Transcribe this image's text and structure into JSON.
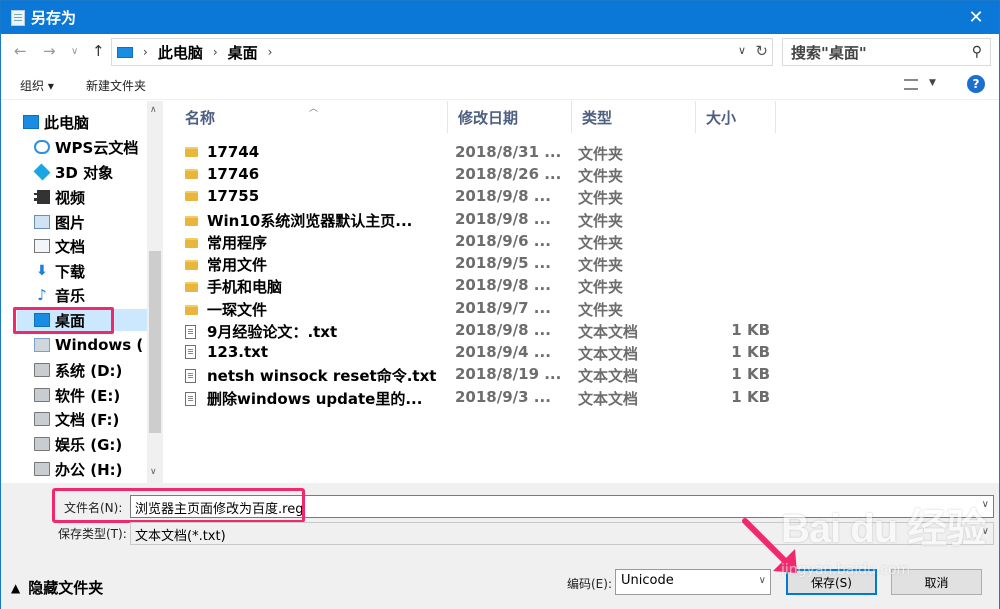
{
  "window": {
    "title": "另存为"
  },
  "address": {
    "crumbs": [
      "此电脑",
      "桌面"
    ],
    "search_placeholder": "搜索\"桌面\""
  },
  "toolbar": {
    "organize": "组织 ▾",
    "new_folder": "新建文件夹",
    "help": "?"
  },
  "nav": {
    "items": [
      {
        "label": "此电脑",
        "icon": "pc-icon"
      },
      {
        "label": "WPS云文档",
        "icon": "cloud-icon"
      },
      {
        "label": "3D 对象",
        "icon": "3d-objects-icon"
      },
      {
        "label": "视频",
        "icon": "video-icon"
      },
      {
        "label": "图片",
        "icon": "picture-icon"
      },
      {
        "label": "文档",
        "icon": "document-icon"
      },
      {
        "label": "下载",
        "icon": "download-icon"
      },
      {
        "label": "音乐",
        "icon": "music-icon"
      },
      {
        "label": "桌面",
        "icon": "desktop-icon",
        "selected": true
      },
      {
        "label": "Windows (",
        "icon": "windows-drive-icon"
      },
      {
        "label": "系统 (D:)",
        "icon": "drive-icon"
      },
      {
        "label": "软件 (E:)",
        "icon": "drive-icon"
      },
      {
        "label": "文档 (F:)",
        "icon": "drive-icon"
      },
      {
        "label": "娱乐 (G:)",
        "icon": "drive-icon"
      },
      {
        "label": "办公 (H:)",
        "icon": "drive-icon"
      }
    ]
  },
  "columns": {
    "name": "名称",
    "date": "修改日期",
    "type": "类型",
    "size": "大小"
  },
  "files": [
    {
      "name": "17744",
      "date": "2018/8/31 ...",
      "type": "文件夹",
      "size": "",
      "kind": "folder"
    },
    {
      "name": "17746",
      "date": "2018/8/26 ...",
      "type": "文件夹",
      "size": "",
      "kind": "folder"
    },
    {
      "name": "17755",
      "date": "2018/9/8 ...",
      "type": "文件夹",
      "size": "",
      "kind": "folder"
    },
    {
      "name": "Win10系统浏览器默认主页...",
      "date": "2018/9/8 ...",
      "type": "文件夹",
      "size": "",
      "kind": "folder"
    },
    {
      "name": "常用程序",
      "date": "2018/9/6 ...",
      "type": "文件夹",
      "size": "",
      "kind": "folder"
    },
    {
      "name": "常用文件",
      "date": "2018/9/5 ...",
      "type": "文件夹",
      "size": "",
      "kind": "folder"
    },
    {
      "name": "手机和电脑",
      "date": "2018/9/8 ...",
      "type": "文件夹",
      "size": "",
      "kind": "folder"
    },
    {
      "name": "一琛文件",
      "date": "2018/9/7 ...",
      "type": "文件夹",
      "size": "",
      "kind": "folder"
    },
    {
      "name": "9月经验论文：.txt",
      "date": "2018/9/8 ...",
      "type": "文本文档",
      "size": "1 KB",
      "kind": "txt"
    },
    {
      "name": "123.txt",
      "date": "2018/9/4 ...",
      "type": "文本文档",
      "size": "1 KB",
      "kind": "txt"
    },
    {
      "name": "netsh winsock reset命令.txt",
      "date": "2018/8/19 ...",
      "type": "文本文档",
      "size": "1 KB",
      "kind": "txt"
    },
    {
      "name": "删除windows update里的...",
      "date": "2018/9/3 ...",
      "type": "文本文档",
      "size": "1 KB",
      "kind": "txt"
    }
  ],
  "form": {
    "filename_label": "文件名(N):",
    "filename_value": "浏览器主页面修改为百度.reg",
    "filetype_label": "保存类型(T):",
    "filetype_value": "文本文档(*.txt)",
    "encoding_label": "编码(E):",
    "encoding_value": "Unicode",
    "hide_folders": "隐藏文件夹",
    "save_button": "保存(S)",
    "cancel_button": "取消"
  },
  "watermark": {
    "brand": "Bai du 经验",
    "url": "jingyan.baidu.com"
  },
  "colors": {
    "titlebar": "#0b78d7",
    "highlight": "#f0296c",
    "column_header": "#4d6082"
  }
}
